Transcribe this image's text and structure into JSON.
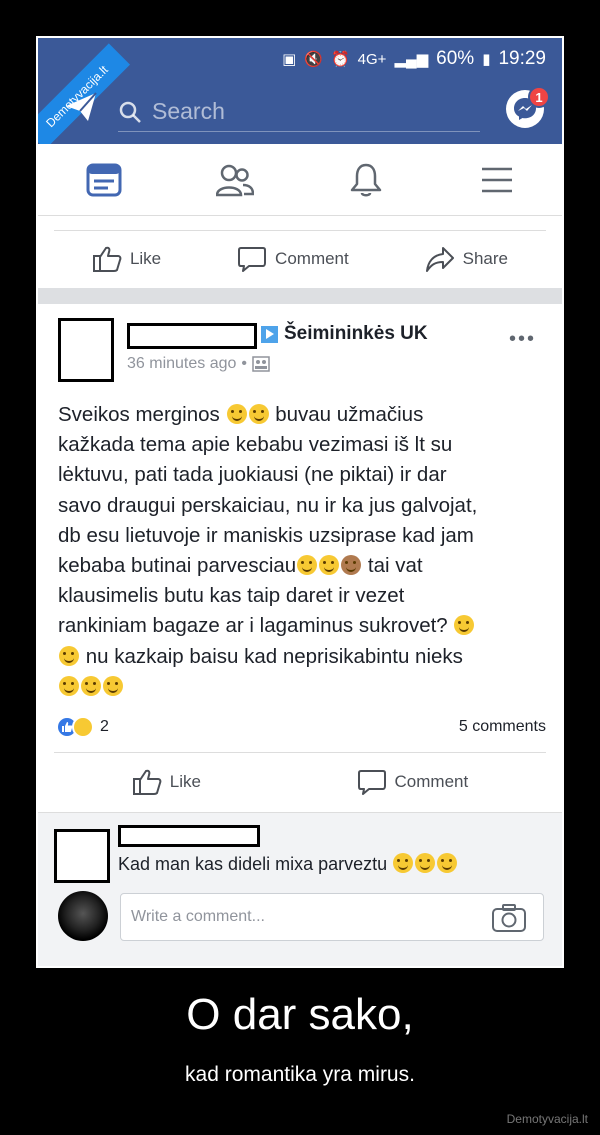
{
  "watermark_badge": "Demotyvacija.lt",
  "status_bar": {
    "network": "4G+",
    "battery": "60%",
    "time": "19:29"
  },
  "header": {
    "search_placeholder": "Search",
    "messenger_badge": "1"
  },
  "top_actions": {
    "like": "Like",
    "comment": "Comment",
    "share": "Share"
  },
  "post": {
    "page_name": "Šeimininkės UK",
    "time": "36 minutes ago",
    "text_lines": [
      "Sveikos merginos",
      "buvau užmačius",
      "kažkada tema apie kebabu vezimasi iš lt su",
      "lėktuvu, pati tada juokiausi (ne piktai) ir dar",
      "savo draugui perskaiciau, nu ir ka jus galvojat,",
      "db esu lietuvoje ir maniskis uzsiprase kad jam",
      "kebaba butinai parvesciau",
      "tai vat",
      "klausimelis butu kas taip daret ir vezet",
      "rankiniam bagaze ar i lagaminus sukrovet?",
      "nu kazkaip baisu kad neprisikabintu nieks"
    ],
    "reaction_count": "2",
    "comments_count": "5 comments",
    "like_label": "Like",
    "comment_label": "Comment"
  },
  "comment": {
    "text": "Kad man kas dideli mixa parveztu"
  },
  "write_comment": {
    "placeholder": "Write a comment..."
  },
  "caption": {
    "title": "O dar sako,",
    "subtitle": "kad romantika yra mirus."
  },
  "site": "Demotyvacija.lt",
  "colors": {
    "header_bg": "#3b5998",
    "nav_active": "#4267b2"
  }
}
